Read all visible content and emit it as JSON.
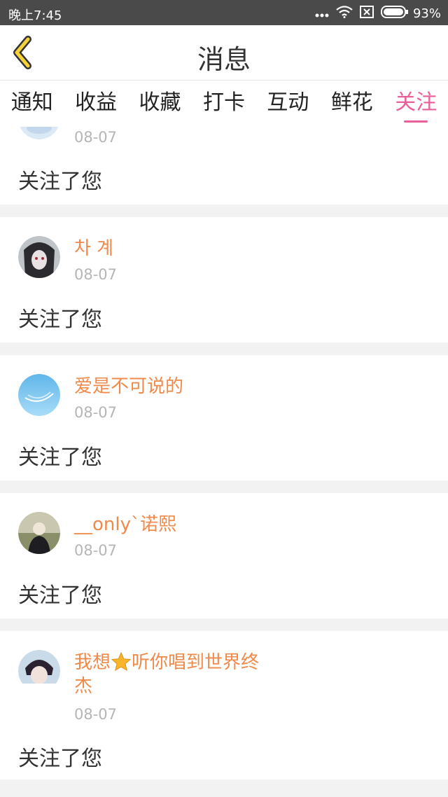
{
  "status": {
    "time": "晚上7:45",
    "battery": "93%"
  },
  "header": {
    "title": "消息"
  },
  "tabs": [
    "通知",
    "收益",
    "收藏",
    "打卡",
    "互动",
    "鲜花",
    "关注"
  ],
  "active_tab": "关注",
  "items": [
    {
      "name": "",
      "date": "08-07",
      "message": "关注了您"
    },
    {
      "name": "차 계",
      "date": "08-07",
      "message": "关注了您"
    },
    {
      "name": "爱是不可说的",
      "date": "08-07",
      "message": "关注了您"
    },
    {
      "name": "__only`诺熙",
      "date": "08-07",
      "message": "关注了您"
    },
    {
      "name_part1": "我想",
      "name_part2": "听你唱到世界终",
      "name_line2": "杰",
      "date": "08-07",
      "message": "关注了您"
    }
  ],
  "colors": {
    "accent": "#e8609a",
    "username": "#f08a4b",
    "date": "#b5b5b5"
  }
}
